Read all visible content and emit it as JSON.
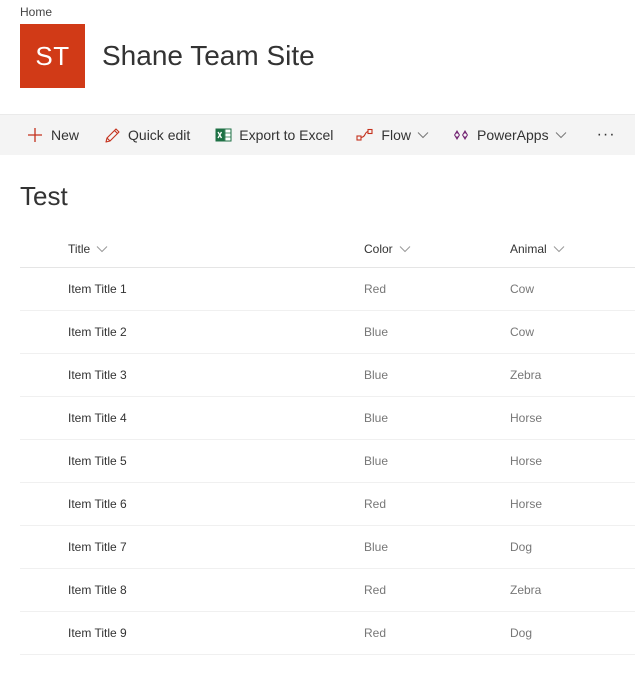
{
  "breadcrumb": "Home",
  "site": {
    "logo_initials": "ST",
    "logo_color": "#d13a17",
    "title": "Shane Team Site"
  },
  "commandbar": {
    "new_label": "New",
    "quick_edit_label": "Quick edit",
    "export_label": "Export to Excel",
    "flow_label": "Flow",
    "powerapps_label": "PowerApps",
    "more_label": "···"
  },
  "list": {
    "title": "Test",
    "columns": [
      "Title",
      "Color",
      "Animal"
    ],
    "rows": [
      {
        "title": "Item Title 1",
        "color": "Red",
        "animal": "Cow"
      },
      {
        "title": "Item Title 2",
        "color": "Blue",
        "animal": "Cow"
      },
      {
        "title": "Item Title 3",
        "color": "Blue",
        "animal": "Zebra"
      },
      {
        "title": "Item Title 4",
        "color": "Blue",
        "animal": "Horse"
      },
      {
        "title": "Item Title 5",
        "color": "Blue",
        "animal": "Horse"
      },
      {
        "title": "Item Title 6",
        "color": "Red",
        "animal": "Horse"
      },
      {
        "title": "Item Title 7",
        "color": "Blue",
        "animal": "Dog"
      },
      {
        "title": "Item Title 8",
        "color": "Red",
        "animal": "Zebra"
      },
      {
        "title": "Item Title 9",
        "color": "Red",
        "animal": "Dog"
      }
    ]
  }
}
